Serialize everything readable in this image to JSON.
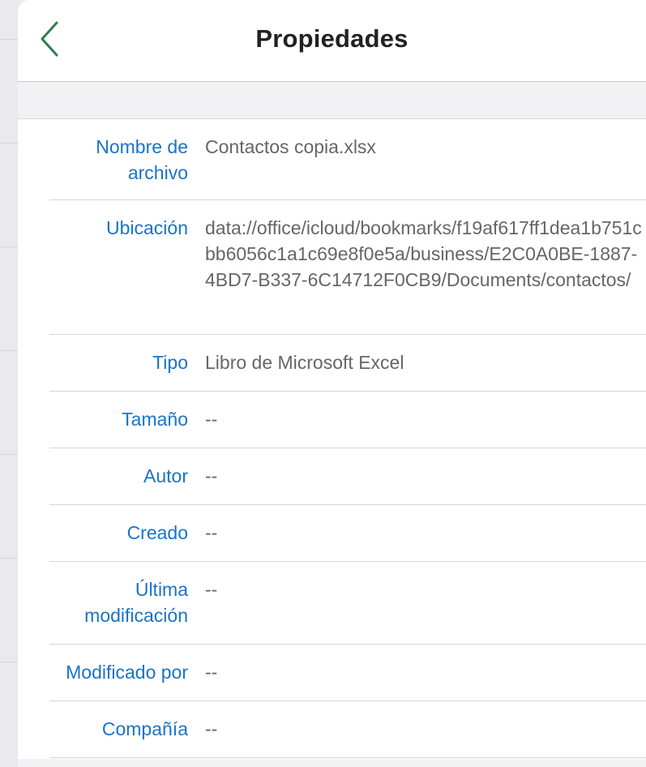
{
  "navbar": {
    "title": "Propiedades",
    "back_icon": "chevron-left-icon",
    "accent_color": "#2e7d4f"
  },
  "properties": [
    {
      "label": "Nombre de archivo",
      "value": "Contactos copia.xlsx"
    },
    {
      "label": "Ubicación",
      "value": "data://office/icloud/bookmarks/f19af617ff1dea1b751cbb6056c1a1c69e8f0e5a/business/E2C0A0BE-1887-4BD7-B337-6C14712F0CB9/Documents/contactos/"
    },
    {
      "label": "Tipo",
      "value": "Libro de Microsoft Excel"
    },
    {
      "label": "Tamaño",
      "value": "--"
    },
    {
      "label": "Autor",
      "value": "--"
    },
    {
      "label": "Creado",
      "value": "--"
    },
    {
      "label": "Última modificación",
      "value": "--"
    },
    {
      "label": "Modificado por",
      "value": "--"
    },
    {
      "label": "Compañía",
      "value": "--"
    }
  ],
  "colors": {
    "label": "#1a73c9",
    "value": "#666666",
    "title": "#222222"
  }
}
